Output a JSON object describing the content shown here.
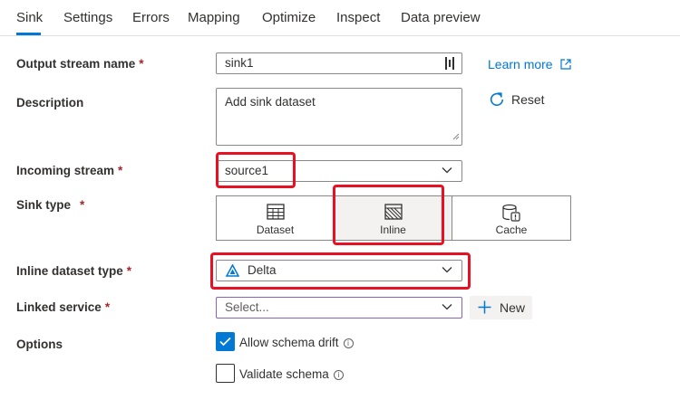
{
  "tabs": [
    {
      "label": "Sink",
      "active": true
    },
    {
      "label": "Settings"
    },
    {
      "label": "Errors"
    },
    {
      "label": "Mapping"
    },
    {
      "label": "Optimize"
    },
    {
      "label": "Inspect"
    },
    {
      "label": "Data preview"
    }
  ],
  "required_mark": "*",
  "form": {
    "output_stream_name": {
      "label": "Output stream name",
      "value": "sink1"
    },
    "description": {
      "label": "Description",
      "value": "Add sink dataset"
    },
    "incoming_stream": {
      "label": "Incoming stream",
      "value": "source1"
    },
    "sink_type": {
      "label": "Sink type",
      "options": [
        {
          "label": "Dataset",
          "icon": "table-icon"
        },
        {
          "label": "Inline",
          "icon": "inline-hatched-icon",
          "selected": true
        },
        {
          "label": "Cache",
          "icon": "cache-database-icon"
        }
      ]
    },
    "inline_dataset_type": {
      "label": "Inline dataset type",
      "value": "Delta",
      "icon": "delta-icon"
    },
    "linked_service": {
      "label": "Linked service",
      "placeholder": "Select...",
      "new_label": "New"
    },
    "options": {
      "label": "Options",
      "allow_schema_drift": {
        "label": "Allow schema drift",
        "checked": true
      },
      "validate_schema": {
        "label": "Validate schema",
        "checked": false
      }
    }
  },
  "side": {
    "learn_more": "Learn more",
    "reset": "Reset"
  },
  "colors": {
    "accent": "#0078d4",
    "highlight": "#e81123",
    "required": "#a4262c"
  }
}
